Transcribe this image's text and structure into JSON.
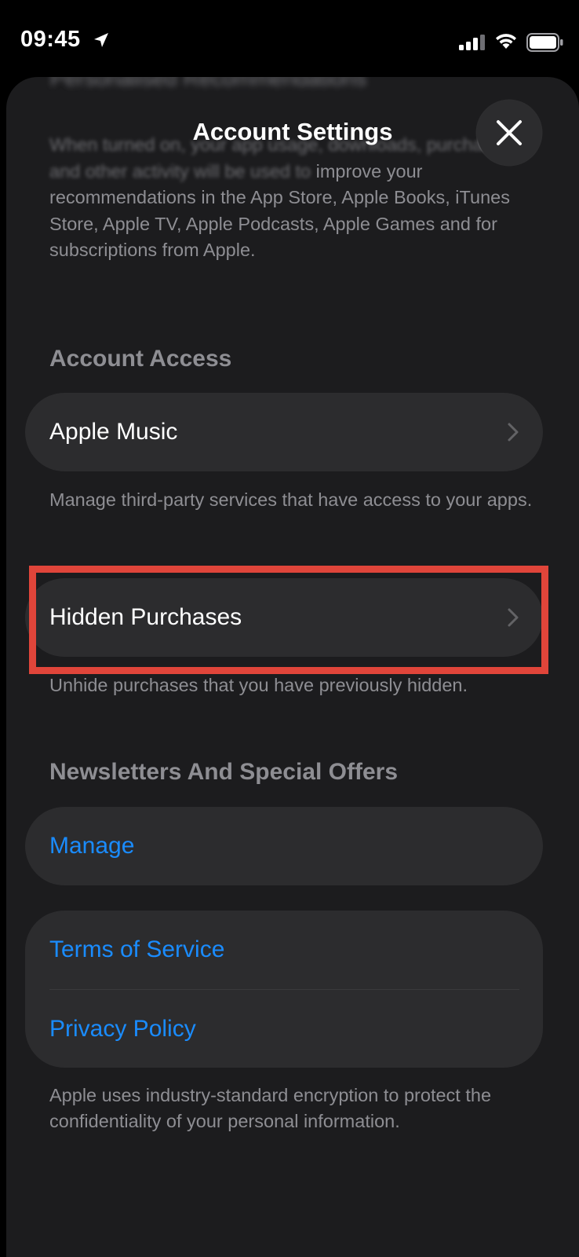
{
  "status_bar": {
    "time": "09:45",
    "icons": [
      "location-arrow-icon",
      "cellular-signal-icon",
      "wifi-icon",
      "battery-icon"
    ]
  },
  "sheet": {
    "title": "Account Settings",
    "close_icon": "close-icon",
    "blurred_header": "Personalised Recommendations",
    "top_description_faded": "When turned on, your app usage, downloads, purchases and other activity will be used to",
    "top_description": "improve your recommendations in the App Store, Apple Books, iTunes Store, Apple TV, Apple Podcasts, Apple Games and for subscriptions from Apple."
  },
  "account_access": {
    "header": "Account Access",
    "item_label": "Apple Music",
    "footnote": "Manage third-party services that have access to your apps."
  },
  "hidden_purchases": {
    "item_label": "Hidden Purchases",
    "footnote": "Unhide purchases that you have previously hidden."
  },
  "newsletters": {
    "header": "Newsletters And Special Offers",
    "manage_label": "Manage"
  },
  "legal": {
    "terms_label": "Terms of Service",
    "privacy_label": "Privacy Policy",
    "footnote": "Apple uses industry-standard encryption to protect the confidentiality of your personal information."
  },
  "colors": {
    "background": "#1c1c1e",
    "cell": "#2c2c2e",
    "link": "#1a8cff",
    "secondary_text": "#8e8e93",
    "highlight": "#e0453a"
  }
}
